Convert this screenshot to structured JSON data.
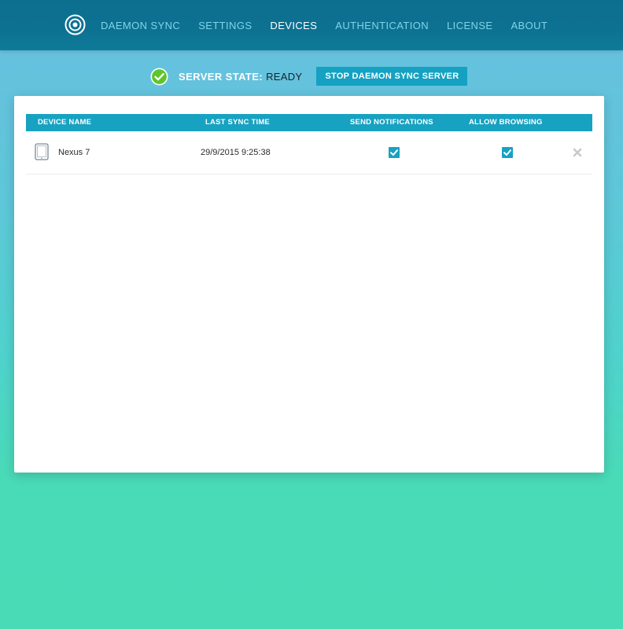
{
  "nav": {
    "items": [
      {
        "label": "DAEMON SYNC",
        "active": false
      },
      {
        "label": "SETTINGS",
        "active": false
      },
      {
        "label": "DEVICES",
        "active": true
      },
      {
        "label": "AUTHENTICATION",
        "active": false
      },
      {
        "label": "LICENSE",
        "active": false
      },
      {
        "label": "ABOUT",
        "active": false
      }
    ]
  },
  "server": {
    "state_label": "SERVER STATE:",
    "state_value": "READY",
    "stop_button": "STOP DAEMON SYNC SERVER"
  },
  "table": {
    "columns": [
      "DEVICE NAME",
      "LAST SYNC TIME",
      "SEND NOTIFICATIONS",
      "ALLOW BROWSING"
    ],
    "rows": [
      {
        "device_icon": "tablet-icon",
        "device_name": "Nexus 7",
        "last_sync_time": "29/9/2015 9:25:38",
        "send_notifications": true,
        "allow_browsing": true,
        "delete_icon": "close-icon"
      }
    ]
  },
  "colors": {
    "accent": "#17a2c2",
    "header_bar": "#0d7191",
    "nav_inactive": "#7fd4ea",
    "ready_check": "#5cc62b"
  }
}
